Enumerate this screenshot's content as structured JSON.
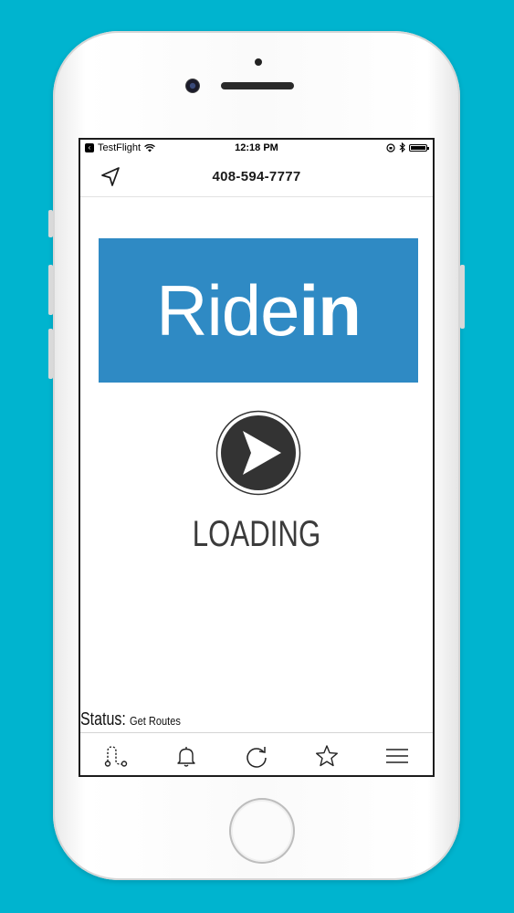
{
  "status_bar": {
    "app_name": "TestFlight",
    "time": "12:18 PM"
  },
  "navbar": {
    "title": "408-594-7777",
    "location_icon": "location-arrow-icon"
  },
  "logo": {
    "part1": "Ride",
    "part2": "in",
    "background": "#2f8ac4"
  },
  "play_icon": "play-icon",
  "loading_label": "LOADING",
  "status": {
    "label": "Status:",
    "value": "Get Routes"
  },
  "tabbar": [
    {
      "icon": "route-icon"
    },
    {
      "icon": "bell-icon"
    },
    {
      "icon": "refresh-icon"
    },
    {
      "icon": "star-icon"
    },
    {
      "icon": "menu-icon"
    }
  ],
  "colors": {
    "background": "#00b4cf",
    "logo_blue": "#2f8ac4"
  }
}
